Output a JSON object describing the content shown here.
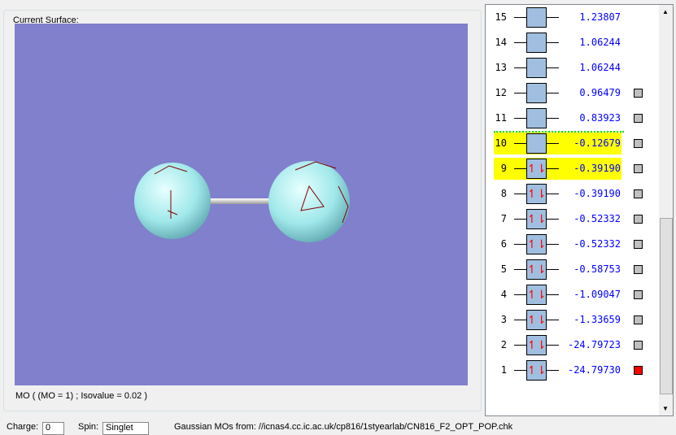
{
  "surface": {
    "label": "Current Surface:",
    "mo_text": "MO ( (MO = 1) ; Isovalue = 0.02 )"
  },
  "orbitals": [
    {
      "n": "15",
      "e": "1.23807",
      "occ": false,
      "hl": false,
      "chk": false
    },
    {
      "n": "14",
      "e": "1.06244",
      "occ": false,
      "hl": false,
      "chk": false
    },
    {
      "n": "13",
      "e": "1.06244",
      "occ": false,
      "hl": false,
      "chk": false
    },
    {
      "n": "12",
      "e": "0.96479",
      "occ": false,
      "hl": false,
      "chk": true
    },
    {
      "n": "11",
      "e": "0.83923",
      "occ": false,
      "hl": false,
      "chk": true
    },
    {
      "n": "10",
      "e": "-0.12679",
      "occ": false,
      "hl": true,
      "chk": true
    },
    {
      "n": "9",
      "e": "-0.39190",
      "occ": true,
      "hl": true,
      "chk": true
    },
    {
      "n": "8",
      "e": "-0.39190",
      "occ": true,
      "hl": false,
      "chk": true
    },
    {
      "n": "7",
      "e": "-0.52332",
      "occ": true,
      "hl": false,
      "chk": true
    },
    {
      "n": "6",
      "e": "-0.52332",
      "occ": true,
      "hl": false,
      "chk": true
    },
    {
      "n": "5",
      "e": "-0.58753",
      "occ": true,
      "hl": false,
      "chk": true
    },
    {
      "n": "4",
      "e": "-1.09047",
      "occ": true,
      "hl": false,
      "chk": true
    },
    {
      "n": "3",
      "e": "-1.33659",
      "occ": true,
      "hl": false,
      "chk": true
    },
    {
      "n": "2",
      "e": "-24.79723",
      "occ": true,
      "hl": false,
      "chk": true
    },
    {
      "n": "1",
      "e": "-24.79730",
      "occ": true,
      "hl": false,
      "chk": true,
      "selected": true
    }
  ],
  "bottom": {
    "charge_label": "Charge:",
    "charge": "0",
    "spin_label": "Spin:",
    "spin": "Singlet",
    "source": "Gaussian MOs from: //icnas4.cc.ic.ac.uk/cp816/1styearlab/CN816_F2_OPT_POP.chk"
  },
  "colors": {
    "view": "#8080cc",
    "highlight": "#ffff00",
    "selected": "#ff0000"
  }
}
